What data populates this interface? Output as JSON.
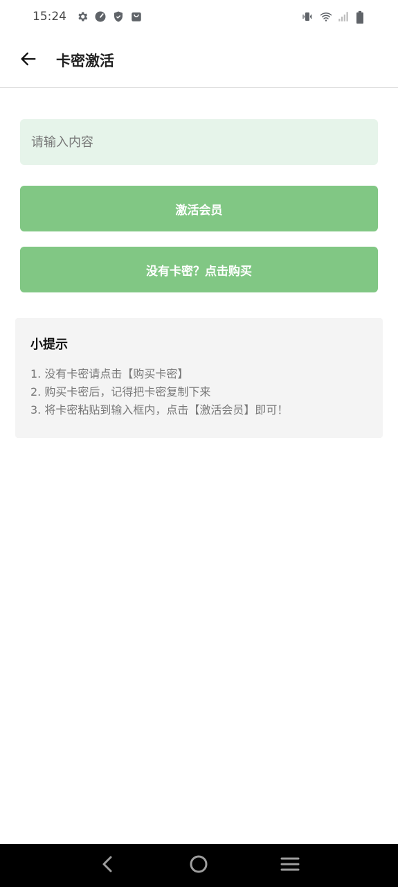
{
  "status_bar": {
    "time": "15:24",
    "left_icons": [
      "settings-gear-icon",
      "speedometer-icon",
      "shield-icon",
      "shopping-bag-icon"
    ],
    "right_icons": [
      "vibrate-icon",
      "wifi-icon",
      "cell-signal-icon",
      "battery-icon"
    ]
  },
  "app_bar": {
    "title": "卡密激活",
    "back_icon": "arrow-left-icon"
  },
  "form": {
    "input_value": "",
    "input_placeholder": "请输入内容",
    "activate_button": "激活会员",
    "buy_button": "没有卡密？点击购买"
  },
  "tips": {
    "title": "小提示",
    "lines": [
      "1. 没有卡密请点击【购买卡密】",
      "2. 购买卡密后，记得把卡密复制下来",
      "3. 将卡密粘贴到输入框内，点击【激活会员】即可！"
    ]
  },
  "colors": {
    "accent": "#81c784",
    "input_bg": "#e6f4ea",
    "tips_bg": "#f4f4f4",
    "nav_bg": "#000000"
  },
  "nav_bar": {
    "buttons": [
      "back-triangle-icon",
      "home-circle-icon",
      "menu-lines-icon"
    ]
  }
}
